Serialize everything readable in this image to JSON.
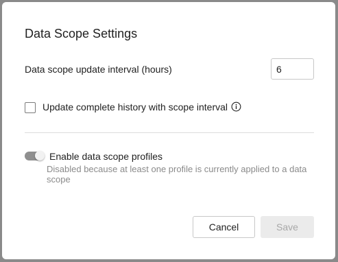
{
  "dialog": {
    "title": "Data Scope Settings",
    "update_interval": {
      "label": "Data scope update interval (hours)",
      "value": "6"
    },
    "complete_history": {
      "label": "Update complete history with scope interval",
      "checked": false,
      "info_icon": "info-circle-icon"
    },
    "profiles": {
      "label": "Enable data scope profiles",
      "enabled": true,
      "disabled": true,
      "description": "Disabled because at least one profile is currently applied to a data scope"
    },
    "buttons": {
      "cancel": "Cancel",
      "save": "Save"
    }
  },
  "colors": {
    "overlay": "#8a8a8a",
    "toggle_track": "#8f8f8f",
    "save_disabled_bg": "#ebebeb",
    "muted_text": "#8a8a8a"
  }
}
